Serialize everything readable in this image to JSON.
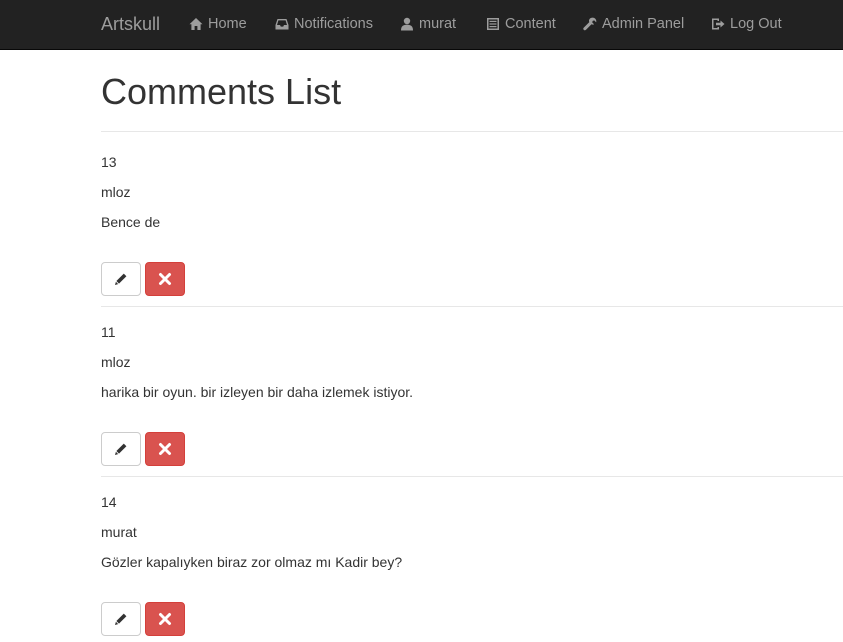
{
  "navbar": {
    "brand": "Artskull",
    "items": [
      {
        "label": "Home",
        "icon": "home-icon"
      },
      {
        "label": "Notifications",
        "icon": "inbox-icon"
      },
      {
        "label": "murat",
        "icon": "user-icon"
      },
      {
        "label": "Content",
        "icon": "list-icon"
      },
      {
        "label": "Admin Panel",
        "icon": "wrench-icon"
      },
      {
        "label": "Log Out",
        "icon": "log-out-icon"
      }
    ]
  },
  "page": {
    "title": "Comments List"
  },
  "comments": [
    {
      "id": "13",
      "user": "mloz",
      "text": "Bence de"
    },
    {
      "id": "11",
      "user": "mloz",
      "text": "harika bir oyun. bir izleyen bir daha izlemek istiyor."
    },
    {
      "id": "14",
      "user": "murat",
      "text": "Gözler kapalıyken biraz zor olmaz mı Kadir bey?"
    }
  ],
  "colors": {
    "navbar_bg": "#222222",
    "nav_text": "#9d9d9d",
    "delete_button": "#d9534f"
  }
}
